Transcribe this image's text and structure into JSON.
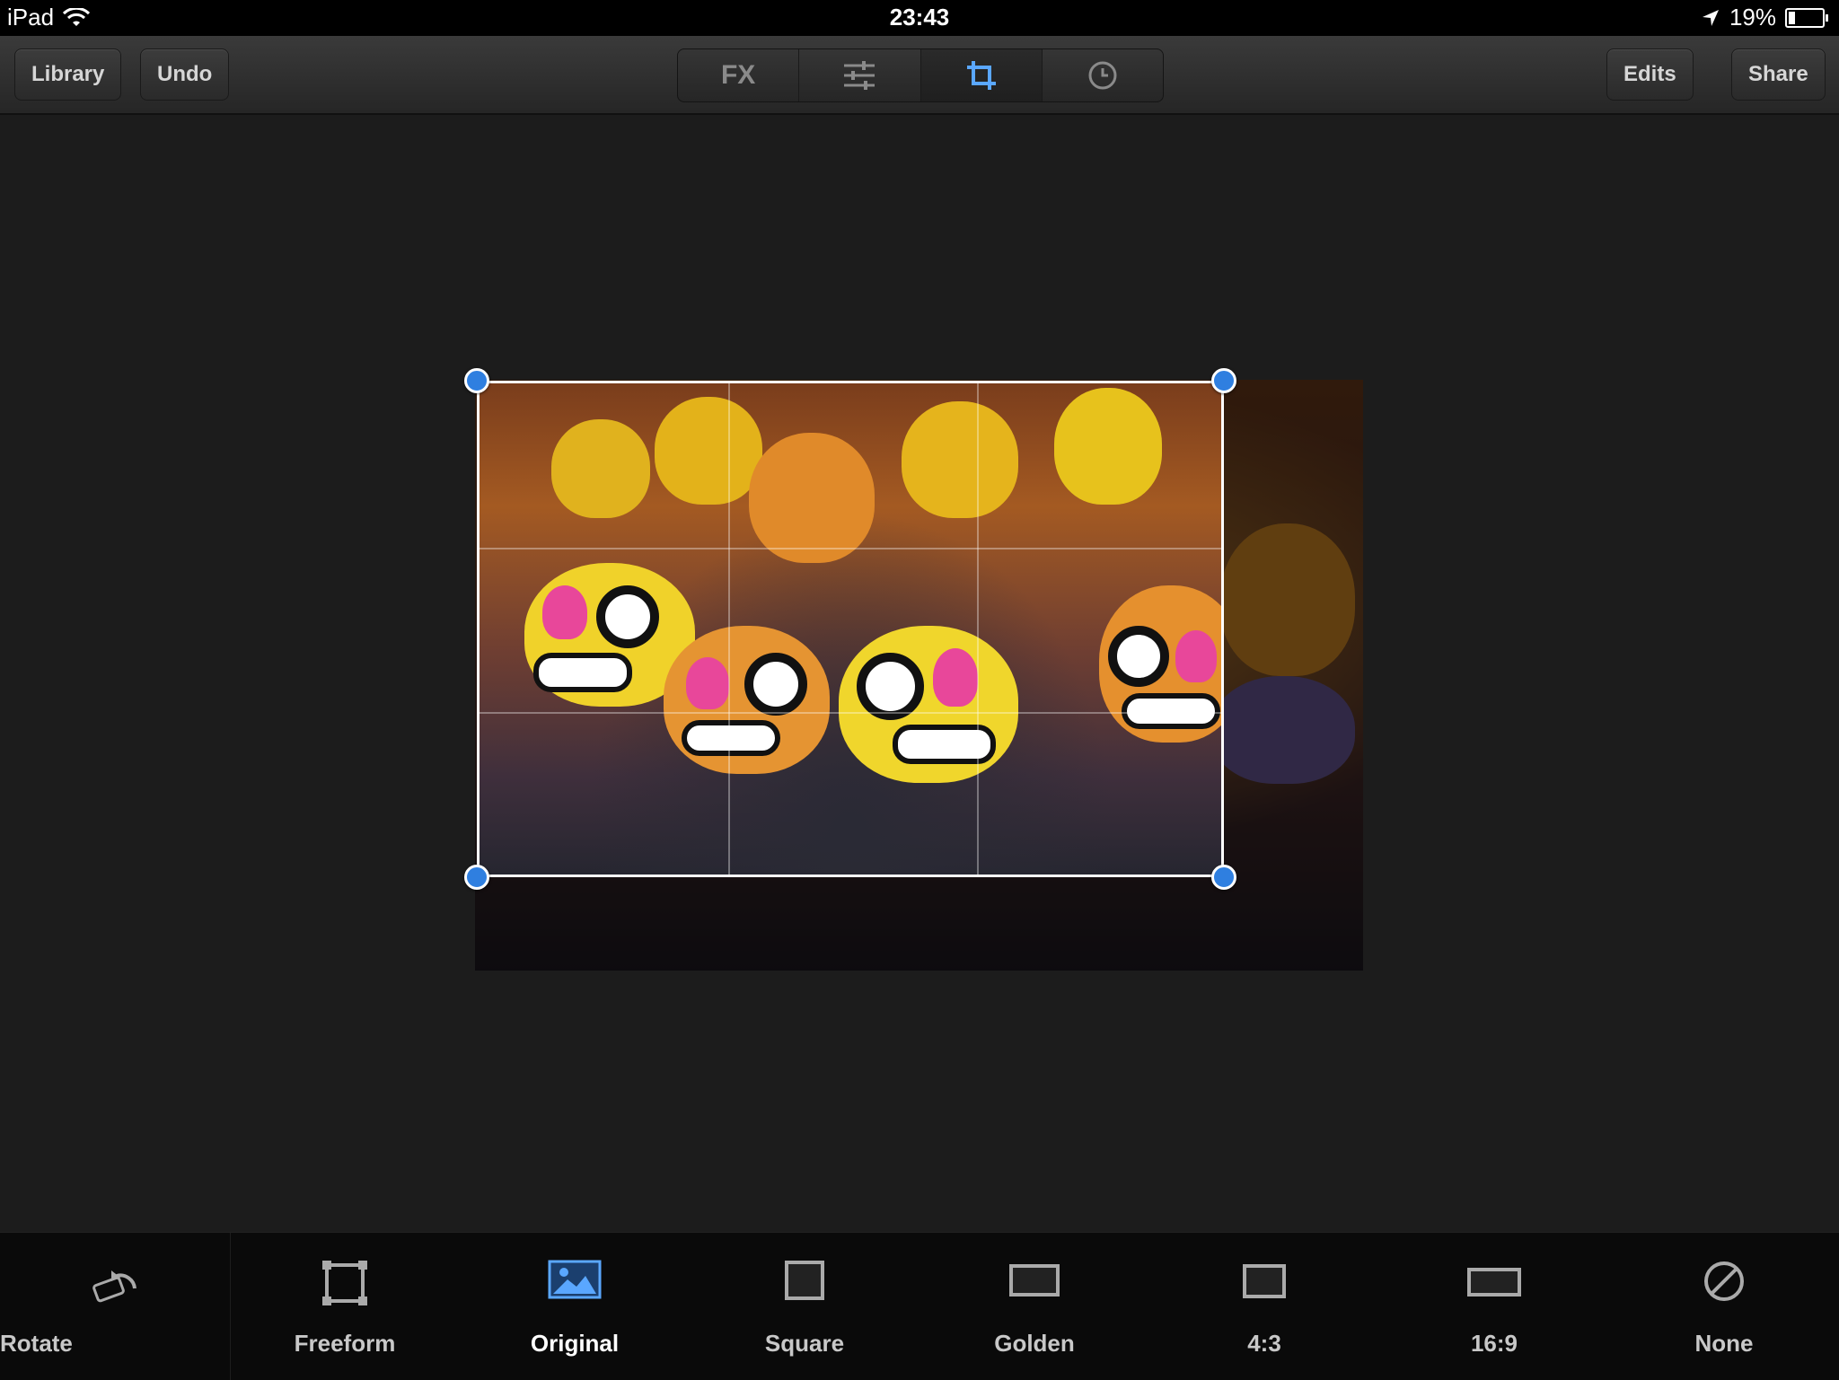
{
  "status_bar": {
    "device": "iPad",
    "time": "23:43",
    "battery": "19%",
    "battery_level": 0.19
  },
  "toolbar": {
    "library_label": "Library",
    "undo_label": "Undo",
    "fx_label": "FX",
    "edits_label": "Edits",
    "share_label": "Share",
    "active_tool": "crop",
    "accent_color": "#5aa7ff"
  },
  "crop": {
    "handle_color": "#2f7fe0",
    "grid": "rule-of-thirds"
  },
  "bottom": {
    "rotate_label": "Rotate",
    "options": [
      {
        "label": "Freeform",
        "icon": "freeform-icon"
      },
      {
        "label": "Original",
        "icon": "image-icon",
        "selected": true
      },
      {
        "label": "Square",
        "icon": "square-icon"
      },
      {
        "label": "Golden",
        "icon": "golden-ratio-icon"
      },
      {
        "label": "4:3",
        "icon": "ratio-4-3-icon"
      },
      {
        "label": "16:9",
        "icon": "ratio-16-9-icon"
      },
      {
        "label": "None",
        "icon": "none-icon"
      }
    ]
  }
}
